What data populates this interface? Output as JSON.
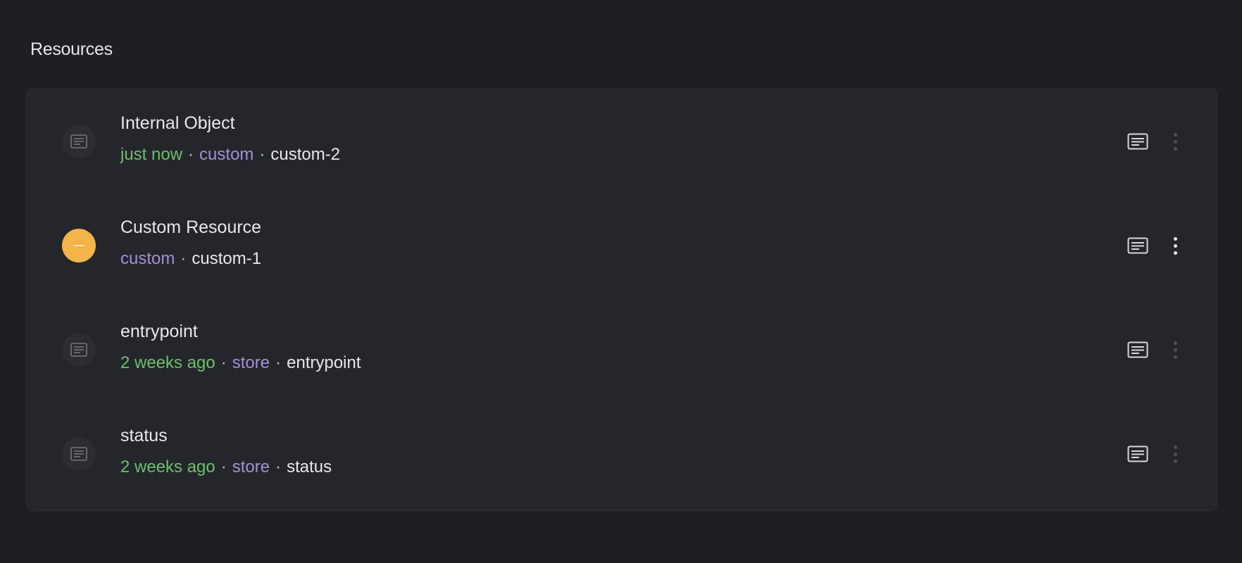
{
  "page": {
    "title": "Resources"
  },
  "colors": {
    "background": "#1e1f23",
    "card": "#25262b",
    "time": "#6cbf6c",
    "kind": "#a58fd6",
    "warning": "#f5b44a"
  },
  "resources": [
    {
      "title": "Internal Object",
      "time": "just now",
      "kind": "custom",
      "name": "custom-2",
      "status_icon": "document-icon"
    },
    {
      "title": "Custom Resource",
      "time": "",
      "kind": "custom",
      "name": "custom-1",
      "status_icon": "pending-dash-icon"
    },
    {
      "title": "entrypoint",
      "time": "2 weeks ago",
      "kind": "store",
      "name": "entrypoint",
      "status_icon": "document-icon"
    },
    {
      "title": "status",
      "time": "2 weeks ago",
      "kind": "store",
      "name": "status",
      "status_icon": "document-icon"
    }
  ],
  "separator": "·",
  "actions": {
    "logs_icon": "logs-icon",
    "more_icon": "more-vertical-icon"
  }
}
